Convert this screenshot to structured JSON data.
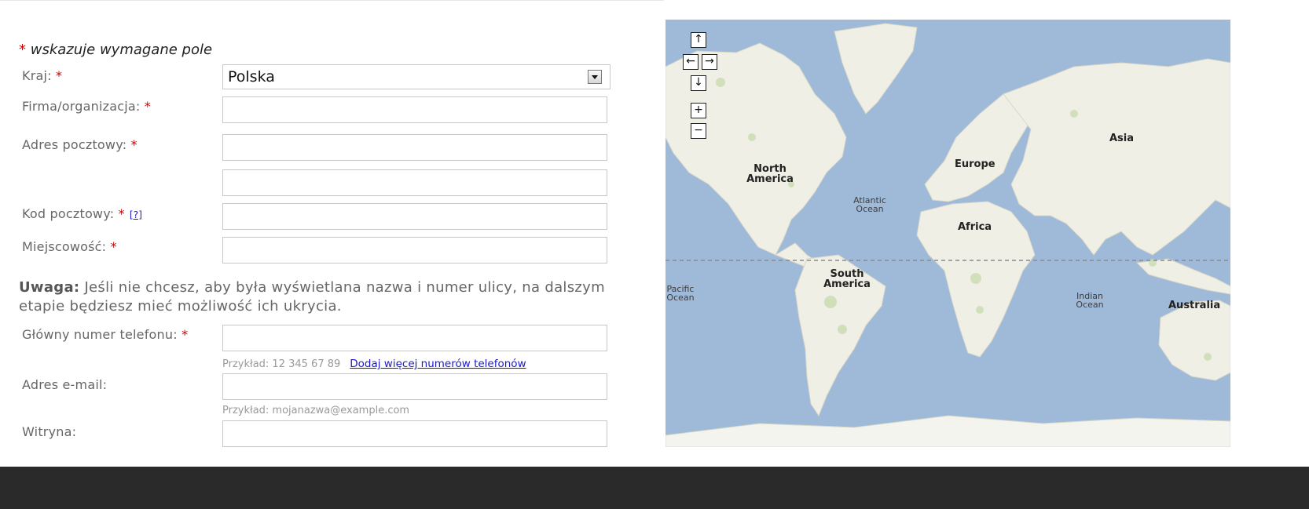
{
  "form": {
    "required_note": "wskazuje wymagane pole",
    "required_mark": "*",
    "country": {
      "label": "Kraj:",
      "value": "Polska"
    },
    "company": {
      "label": "Firma/organizacja:",
      "value": ""
    },
    "address": {
      "label": "Adres pocztowy:",
      "line1": "",
      "line2": ""
    },
    "postal": {
      "label": "Kod pocztowy:",
      "help": "[?]",
      "value": ""
    },
    "city": {
      "label": "Miejscowość:",
      "value": ""
    },
    "note": {
      "bold": "Uwaga:",
      "text": " Jeśli nie chcesz, aby była wyświetlana nazwa i numer ulicy, na dalszym etapie będziesz mieć możliwość ich ukrycia."
    },
    "phone": {
      "label": "Główny numer telefonu:",
      "value": "",
      "hint": "Przykład: 12 345 67 89",
      "add_link": "Dodaj więcej numerów telefonów"
    },
    "email": {
      "label": "Adres e-mail:",
      "value": "",
      "hint": "Przykład: mojanazwa@example.com"
    },
    "website": {
      "label": "Witryna:",
      "value": ""
    }
  },
  "map": {
    "labels": {
      "north_america": "North America",
      "europe": "Europe",
      "asia": "Asia",
      "africa": "Africa",
      "south_america": "South America",
      "australia": "Australia"
    },
    "oceans": {
      "atlantic": "Atlantic Ocean",
      "pacific": "Pacific Ocean",
      "indian": "Indian Ocean"
    },
    "controls": {
      "up": "↑",
      "left": "←",
      "right": "→",
      "down": "↓",
      "zoom_in": "+",
      "zoom_out": "−"
    },
    "colors": {
      "water": "#9fb9d9",
      "land": "#efefe6",
      "vegetation": "#c9dcb0",
      "equator": "#8a8a8a"
    }
  },
  "footer": {
    "color": "#2a2a2a"
  }
}
